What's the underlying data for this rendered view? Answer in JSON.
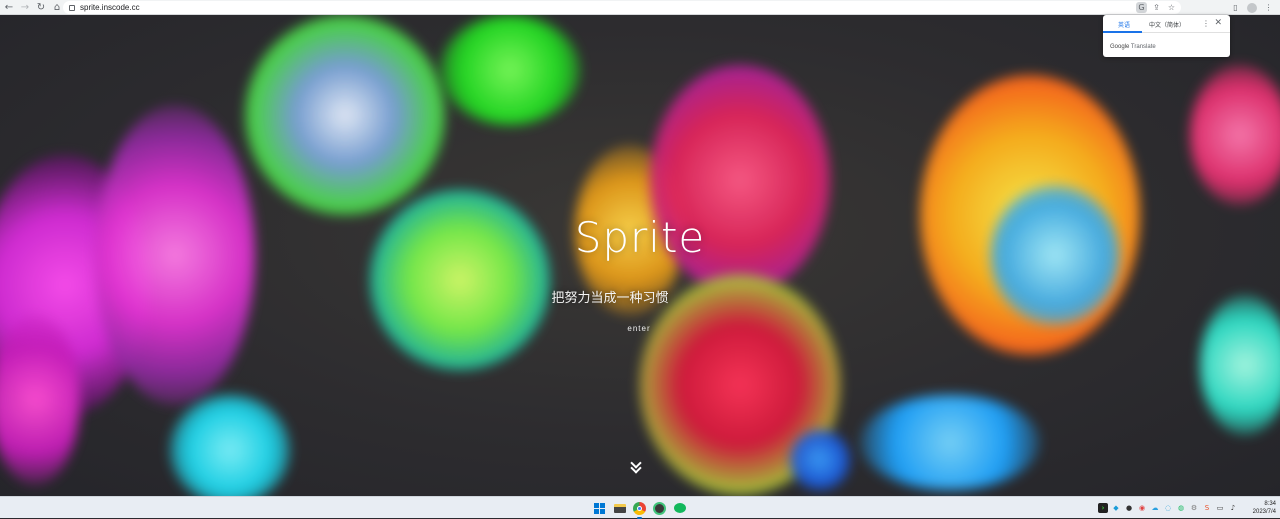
{
  "browser": {
    "url": "sprite.inscode.cc",
    "nav_icons": [
      "back-icon",
      "forward-icon",
      "reload-icon",
      "home-icon"
    ],
    "omnibox_icons": [
      "translate-icon",
      "share-icon",
      "bookmark-star-icon"
    ],
    "right_icons": [
      "side-panel-icon",
      "profile-icon",
      "menu-icon"
    ]
  },
  "hero": {
    "title": "Sprite",
    "subtitle": "把努力当成一种习惯",
    "enter_label": "enter"
  },
  "translate_popup": {
    "tabs": [
      "英语",
      "中文（简体）"
    ],
    "selected_tab": "英语",
    "brand_google": "Google",
    "brand_translate": "Translate"
  },
  "taskbar": {
    "apps": [
      "start-icon",
      "file-explorer-icon",
      "chrome-icon",
      "app-icon",
      "wechat-icon"
    ],
    "tray_icons": [
      "terminal-icon",
      "app-tray-icon",
      "qq-icon",
      "app-tray-icon",
      "cloud-icon",
      "network-tray-icon",
      "wechat-tray-icon",
      "settings-tray-icon",
      "sogou-ime-icon",
      "display-icon",
      "volume-icon"
    ],
    "time": "8:34",
    "date": "2023/7/4"
  },
  "colors": {
    "accent_blue": "#1a73e8",
    "toolbar_bg": "#f1f3f4",
    "taskbar_bg": "#e8edf3"
  }
}
